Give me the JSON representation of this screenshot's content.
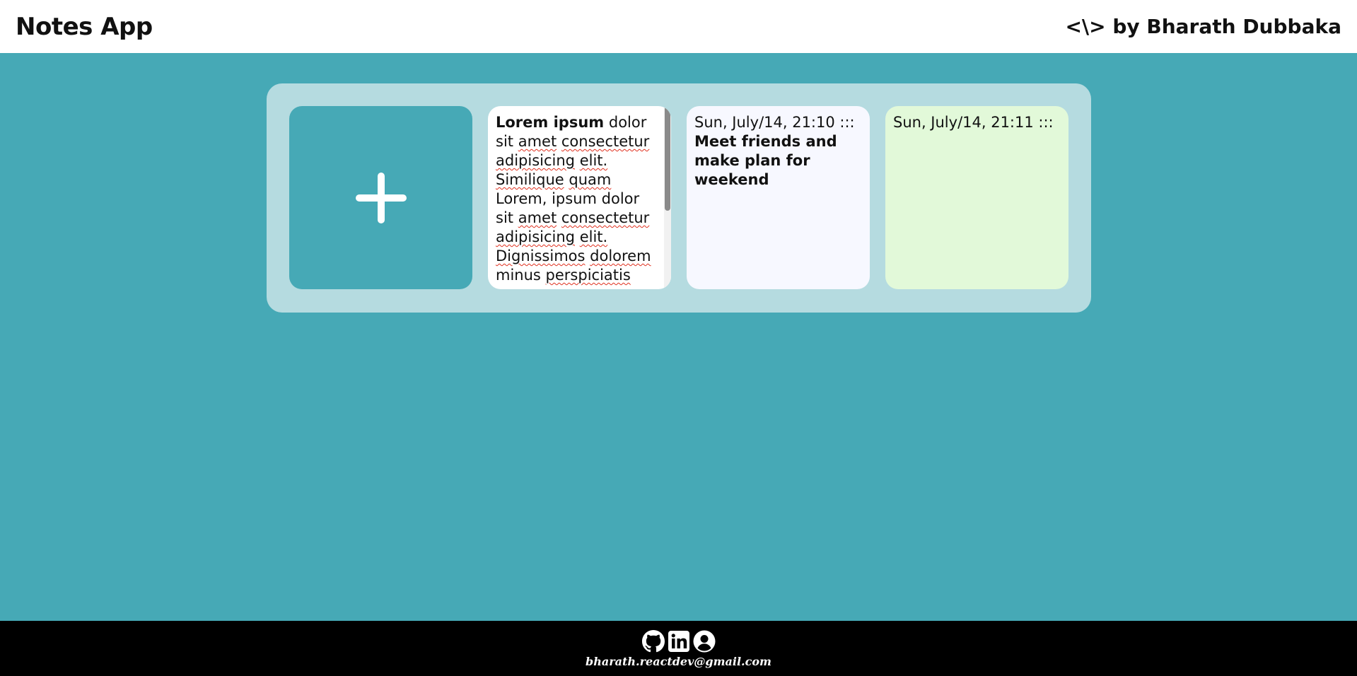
{
  "header": {
    "title": "Notes App",
    "author": "<\\> by Bharath Dubbaka"
  },
  "add_note": {
    "icon": "plus-icon"
  },
  "notes": [
    {
      "color": "#ffffff",
      "bold": "Lorem ipsum",
      "text": "dolor sit amet consectetur adipisicing elit. Similique quam Lorem, ipsum dolor sit amet consectetur adipisicing elit. Dignissimos dolorem minus perspiciatis"
    },
    {
      "color": "#f7f8ff",
      "date": "Sun, July/14, 21:10 :::",
      "bold": "Meet friends and make plan for weekend"
    },
    {
      "color": "#e2f9d9",
      "date": "Sun, July/14, 21:11 :::"
    }
  ],
  "footer": {
    "icons": [
      "github-icon",
      "linkedin-icon",
      "profile-icon"
    ],
    "email": "bharath.reactdev@gmail.com"
  },
  "colors": {
    "background": "#46a9b6",
    "board": "#b5dbe0",
    "header": "#ffffff",
    "footer": "#000000"
  }
}
